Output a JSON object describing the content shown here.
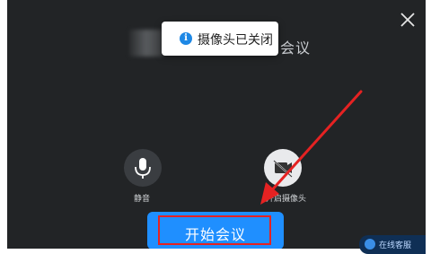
{
  "toast": {
    "icon": "info-icon",
    "icon_glyph": "i",
    "message": "摄像头已关闭"
  },
  "meeting": {
    "title_partial": "会议"
  },
  "controls": {
    "mic_label": "静音",
    "mic_icon": "microphone-icon",
    "camera_label": "开启摄像头",
    "camera_icon": "camera-icon"
  },
  "start_button": {
    "label": "开始会议"
  },
  "window": {
    "close_icon": "close-icon"
  },
  "support_badge": {
    "label": "在线客服"
  },
  "colors": {
    "background": "#222426",
    "accent": "#1f8fff",
    "highlight": "#e52222",
    "toast_icon": "#1e88e5"
  }
}
